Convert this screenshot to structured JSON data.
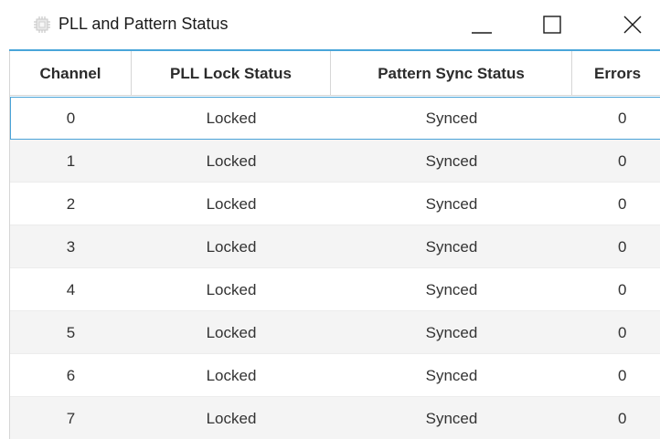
{
  "window": {
    "title": "PLL and Pattern Status",
    "app_icon": "chip-icon",
    "controls": {
      "minimize_icon": "minimize-icon",
      "maximize_icon": "maximize-icon",
      "close_icon": "close-icon"
    }
  },
  "colors": {
    "accent": "#49a5d9",
    "selection_border": "#4aa3d8",
    "alt_row": "#f4f4f4"
  },
  "table": {
    "columns": [
      "Channel",
      "PLL Lock Status",
      "Pattern Sync Status",
      "Errors"
    ],
    "selected_row": 0,
    "rows": [
      [
        "0",
        "Locked",
        "Synced",
        "0"
      ],
      [
        "1",
        "Locked",
        "Synced",
        "0"
      ],
      [
        "2",
        "Locked",
        "Synced",
        "0"
      ],
      [
        "3",
        "Locked",
        "Synced",
        "0"
      ],
      [
        "4",
        "Locked",
        "Synced",
        "0"
      ],
      [
        "5",
        "Locked",
        "Synced",
        "0"
      ],
      [
        "6",
        "Locked",
        "Synced",
        "0"
      ],
      [
        "7",
        "Locked",
        "Synced",
        "0"
      ]
    ]
  }
}
